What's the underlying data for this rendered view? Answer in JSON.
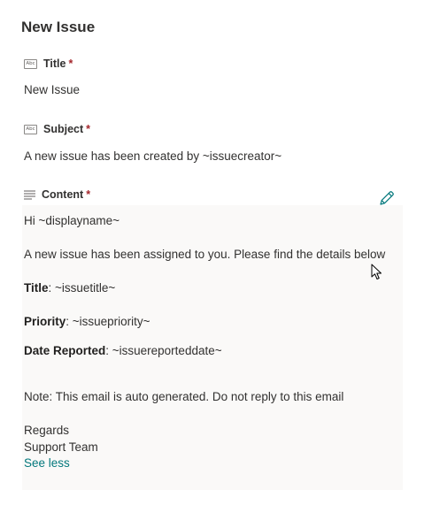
{
  "panel": {
    "title": "New Issue"
  },
  "fields": {
    "title": {
      "label": "Title",
      "required_mark": "*",
      "value": "New Issue",
      "icon": "text-field-icon"
    },
    "subject": {
      "label": "Subject",
      "required_mark": "*",
      "value": "A new issue has been created by ~issuecreator~",
      "icon": "text-field-icon"
    },
    "content": {
      "label": "Content",
      "required_mark": "*",
      "icon": "multiline-text-icon",
      "edit_icon": "pencil-icon",
      "greeting": "Hi ~displayname~",
      "intro": "A new issue has been assigned to you. Please find the details below",
      "issue_title_label": "Title",
      "issue_title_value": ": ~issuetitle~",
      "priority_label": "Priority",
      "priority_value": ": ~issuepriority~",
      "date_label": "Date Reported",
      "date_value": ": ~issuereporteddate~",
      "note": "Note: This email is auto generated. Do not reply to this email",
      "regards": "Regards",
      "signature": "Support Team",
      "see_less": "See less"
    }
  },
  "colors": {
    "text": "#323130",
    "required": "#a4262c",
    "link": "#03787c",
    "content_bg": "#faf9f8",
    "edit_icon": "#03787c"
  }
}
